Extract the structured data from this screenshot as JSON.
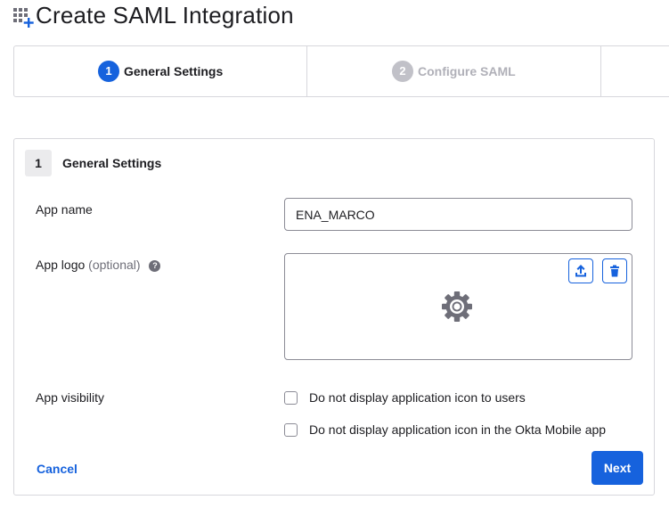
{
  "header": {
    "title": "Create SAML Integration",
    "icon": "app-add-icon"
  },
  "stepper": {
    "steps": [
      {
        "number": "1",
        "label": "General Settings",
        "state": "active"
      },
      {
        "number": "2",
        "label": "Configure SAML",
        "state": "inactive"
      }
    ]
  },
  "section": {
    "number": "1",
    "title": "General Settings"
  },
  "fields": {
    "app_name": {
      "label": "App name",
      "value": "ENA_MARCO"
    },
    "app_logo": {
      "label": "App logo",
      "optional": "(optional)",
      "help_glyph": "?",
      "placeholder_icon": "gear-icon",
      "upload_icon": "upload-icon",
      "delete_icon": "trash-icon"
    },
    "app_visibility": {
      "label": "App visibility",
      "options": [
        {
          "label": "Do not display application icon to users",
          "checked": false
        },
        {
          "label": "Do not display application icon in the Okta Mobile app",
          "checked": false
        }
      ]
    }
  },
  "actions": {
    "cancel": "Cancel",
    "next": "Next"
  },
  "colors": {
    "accent": "#1662dd",
    "inactive_step": "#c1c1c8",
    "border": "#d7d7dc"
  }
}
